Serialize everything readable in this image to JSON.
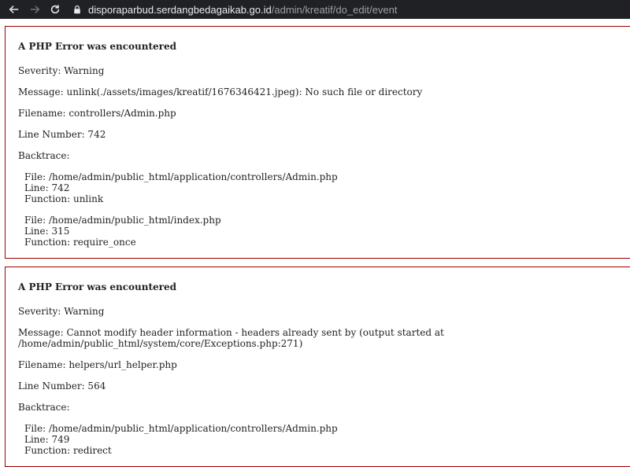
{
  "browser": {
    "url_host": "disporaparbud.serdangbedagaikab.go.id",
    "url_path": "/admin/kreatif/do_edit/event"
  },
  "errors": [
    {
      "heading": "A PHP Error was encountered",
      "severity": "Severity: Warning",
      "message": "Message: unlink(./assets/images/kreatif/1676346421.jpeg): No such file or directory",
      "filename": "Filename: controllers/Admin.php",
      "line_number": "Line Number: 742",
      "backtrace_label": "Backtrace:",
      "backtrace": [
        {
          "file": "File: /home/admin/public_html/application/controllers/Admin.php",
          "line": "Line: 742",
          "function": "Function: unlink"
        },
        {
          "file": "File: /home/admin/public_html/index.php",
          "line": "Line: 315",
          "function": "Function: require_once"
        }
      ]
    },
    {
      "heading": "A PHP Error was encountered",
      "severity": "Severity: Warning",
      "message": "Message: Cannot modify header information - headers already sent by (output started at /home/admin/public_html/system/core/Exceptions.php:271)",
      "filename": "Filename: helpers/url_helper.php",
      "line_number": "Line Number: 564",
      "backtrace_label": "Backtrace:",
      "backtrace": [
        {
          "file": "File: /home/admin/public_html/application/controllers/Admin.php",
          "line": "Line: 749",
          "function": "Function: redirect"
        }
      ]
    }
  ]
}
